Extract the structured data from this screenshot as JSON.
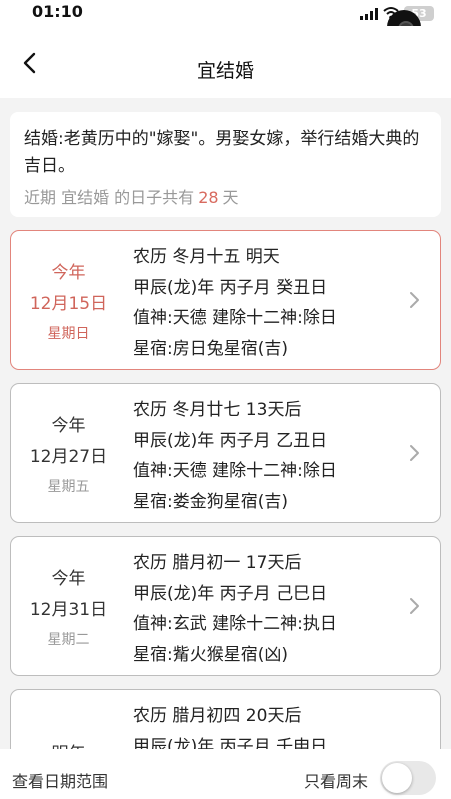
{
  "status_bar": {
    "time": "01:10",
    "battery": "53"
  },
  "header": {
    "title": "宜结婚"
  },
  "intro": {
    "description": "结婚:老黄历中的\"嫁娶\"。男娶女嫁，举行结婚大典的吉日。",
    "count_prefix": "近期 宜结婚 的日子共有",
    "count_value": "28",
    "count_suffix": "天"
  },
  "days": [
    {
      "year_label": "今年",
      "date": "12月15日",
      "weekday": "星期日",
      "lunar": "农历  冬月十五    明天",
      "ganzhi": "甲辰(龙)年 丙子月 癸丑日",
      "shen": "值神:天德  建除十二神:除日",
      "xingxiu": "星宿:房日兔星宿(吉)"
    },
    {
      "year_label": "今年",
      "date": "12月27日",
      "weekday": "星期五",
      "lunar": "农历  冬月廿七    13天后",
      "ganzhi": "甲辰(龙)年 丙子月 乙丑日",
      "shen": "值神:天德  建除十二神:除日",
      "xingxiu": "星宿:娄金狗星宿(吉)"
    },
    {
      "year_label": "今年",
      "date": "12月31日",
      "weekday": "星期二",
      "lunar": "农历  腊月初一    17天后",
      "ganzhi": "甲辰(龙)年 丙子月 己巳日",
      "shen": "值神:玄武  建除十二神:执日",
      "xingxiu": "星宿:觜火猴星宿(凶)"
    },
    {
      "year_label": "明年",
      "date": "",
      "weekday": "",
      "lunar": "农历  腊月初四    20天后",
      "ganzhi": "甲辰(龙)年 丙子月 壬申日",
      "shen": "",
      "xingxiu": ""
    }
  ],
  "footer": {
    "range_link": "查看日期范围",
    "weekend_label": "只看周末"
  },
  "colors": {
    "accent": "#d0655b",
    "today_border": "#e2857c"
  }
}
